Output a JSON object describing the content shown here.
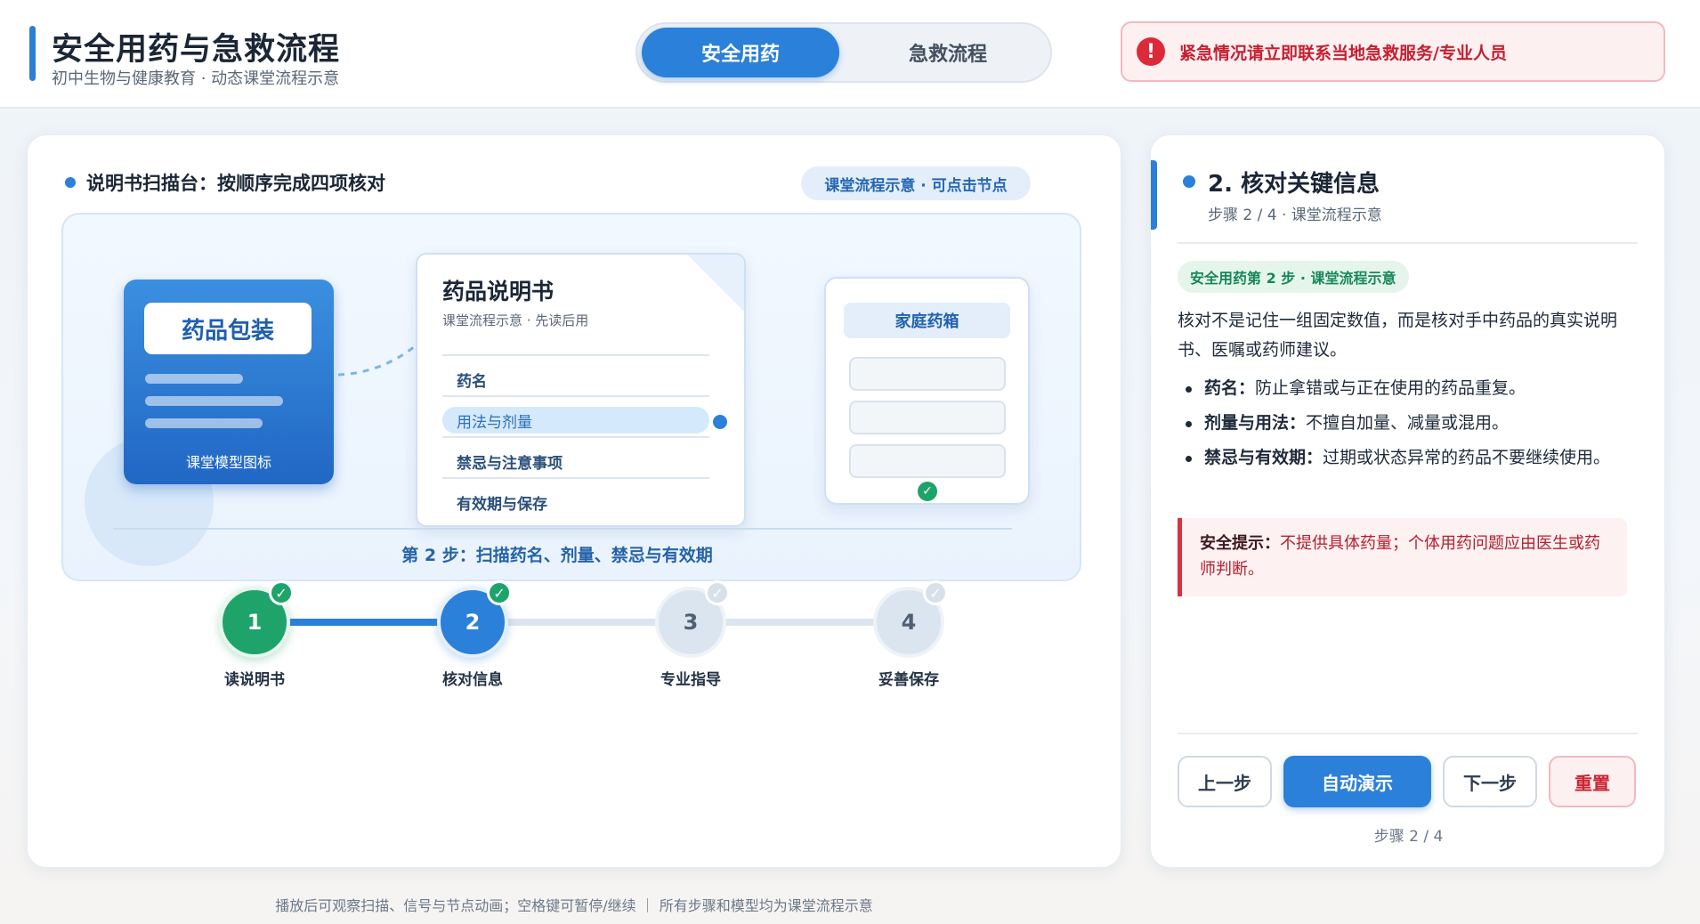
{
  "header": {
    "title": "安全用药与急救流程",
    "subtitle": "初中生物与健康教育 · 动态课堂流程示意",
    "modes": [
      {
        "label": "安全用药",
        "active": true
      },
      {
        "label": "急救流程",
        "active": false
      }
    ],
    "alert": {
      "icon": "!",
      "text": "紧急情况请立即联系当地急救服务/专业人员"
    }
  },
  "scanner": {
    "heading": "说明书扫描台：按顺序完成四项核对",
    "pill": "课堂流程示意 · 可点击节点",
    "package": {
      "label": "药品包装",
      "caption": "课堂模型图标"
    },
    "leaflet": {
      "title": "药品说明书",
      "subtitle": "课堂流程示意 · 先读后用",
      "items": [
        "药名",
        "用法与剂量",
        "禁忌与注意事项",
        "有效期与保存"
      ],
      "active_index": 1
    },
    "cabinet": {
      "label": "家庭药箱",
      "check": "✓"
    },
    "caption": "第 2 步：扫描药名、剂量、禁忌与有效期"
  },
  "stepper": {
    "steps": [
      {
        "num": "1",
        "label": "读说明书",
        "state": "done",
        "badge": "✓"
      },
      {
        "num": "2",
        "label": "核对信息",
        "state": "current",
        "badge": "✓"
      },
      {
        "num": "3",
        "label": "专业指导",
        "state": "todo",
        "badge": "✓"
      },
      {
        "num": "4",
        "label": "妥善保存",
        "state": "todo",
        "badge": "✓"
      }
    ]
  },
  "detail": {
    "title": "2. 核对关键信息",
    "subtitle": "步骤 2 / 4 · 课堂流程示意",
    "tag": "安全用药第 2 步 · 课堂流程示意",
    "description": "核对不是记住一组固定数值，而是核对手中药品的真实说明书、医嘱或药师建议。",
    "points": [
      {
        "key": "药名：",
        "text": "防止拿错或与正在使用的药品重复。"
      },
      {
        "key": "剂量与用法：",
        "text": "不擅自加量、减量或混用。"
      },
      {
        "key": "禁忌与有效期：",
        "text": "过期或状态异常的药品不要继续使用。"
      }
    ],
    "safety": {
      "key": "安全提示：",
      "text": "不提供具体药量；个体用药问题应由医生或药师判断。"
    },
    "buttons": {
      "prev": "上一步",
      "auto": "自动演示",
      "next": "下一步",
      "reset": "重置"
    },
    "counter": "步骤 2 / 4"
  },
  "footer": "播放后可观察扫描、信号与节点动画；空格键可暂停/继续 ｜ 所有步骤和模型均为课堂流程示意",
  "colors": {
    "accent": "#2b80d9",
    "success": "#1ea36b",
    "danger": "#dd2a3a"
  }
}
